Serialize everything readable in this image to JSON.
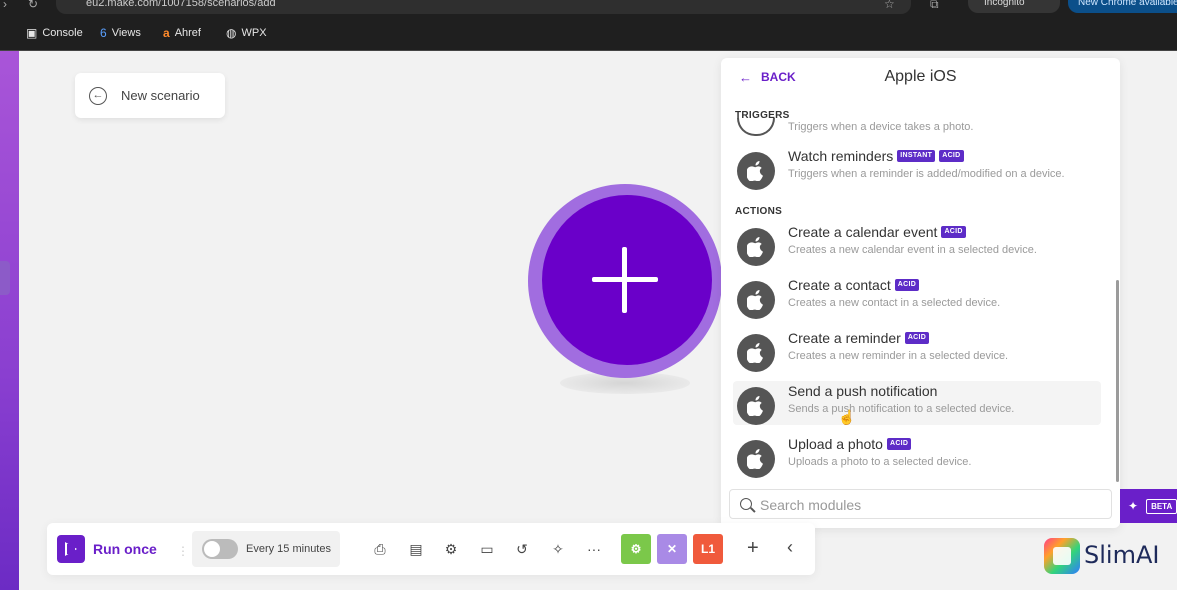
{
  "browser": {
    "url": "eu2.make.com/1007158/scenarios/add",
    "incognito_label": "Incognito",
    "update_label": "New Chrome available",
    "bookmarks": [
      {
        "label": "Console",
        "icon": "cube-icon"
      },
      {
        "label": "Views",
        "icon": "six-icon"
      },
      {
        "label": "Ahref",
        "icon": "ahrefs-icon"
      },
      {
        "label": "WPX",
        "icon": "globe-icon"
      }
    ]
  },
  "scenario": {
    "back_label": "New scenario"
  },
  "panel": {
    "back_label": "BACK",
    "title": "Apple iOS",
    "triggers_label": "TRIGGERS",
    "partial_trigger_desc": "Triggers when a device takes a photo.",
    "actions_label": "ACTIONS",
    "modules": [
      {
        "title": "Watch reminders",
        "badges": [
          "INSTANT",
          "ACID"
        ],
        "desc": "Triggers when a reminder is added/modified on a device."
      },
      {
        "title": "Create a calendar event",
        "badges": [
          "ACID"
        ],
        "desc": "Creates a new calendar event in a selected device."
      },
      {
        "title": "Create a contact",
        "badges": [
          "ACID"
        ],
        "desc": "Creates a new contact in a selected device."
      },
      {
        "title": "Create a reminder",
        "badges": [
          "ACID"
        ],
        "desc": "Creates a new reminder in a selected device."
      },
      {
        "title": "Send a push notification",
        "badges": [],
        "desc": "Sends a push notification to a selected device."
      },
      {
        "title": "Upload a photo",
        "badges": [
          "ACID"
        ],
        "desc": "Uploads a photo to a selected device."
      }
    ],
    "search_placeholder": "Search modules"
  },
  "beta": {
    "label": "BETA"
  },
  "toolbar": {
    "run_label": "Run once",
    "schedule_label": "Every 15 minutes",
    "red_square_label": "L1"
  },
  "watermark": {
    "text": "SlimAI"
  },
  "colors": {
    "accent": "#6a00c9",
    "badge": "#5d2cc7",
    "green": "#7bc84a",
    "lavender": "#a98ae6",
    "orange": "#f05a3c"
  }
}
